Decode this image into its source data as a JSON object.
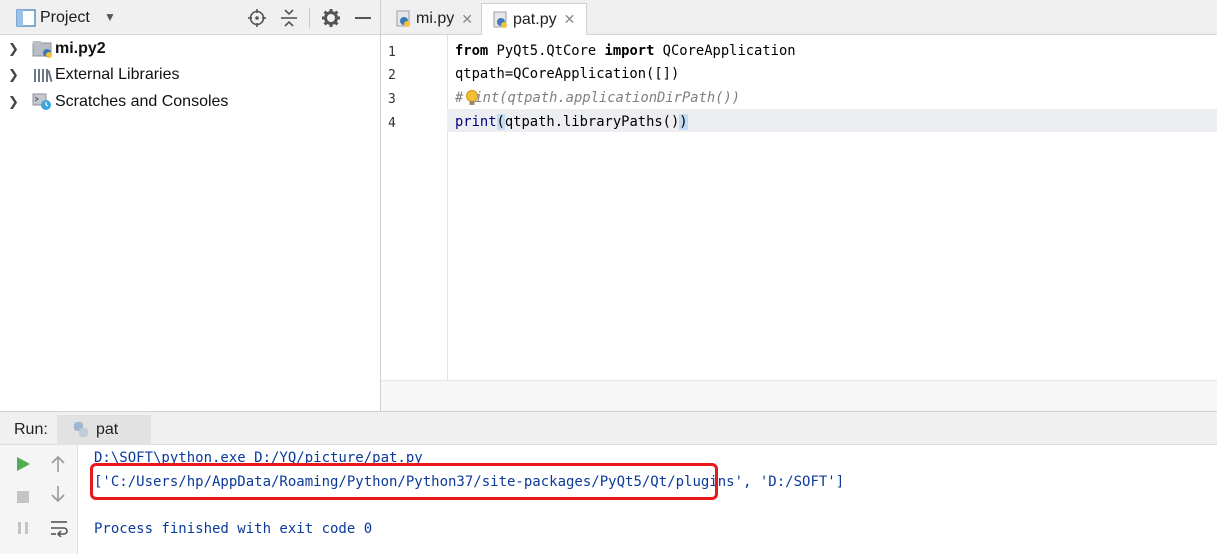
{
  "project": {
    "title": "Project",
    "tree": [
      {
        "label": "mi.py2",
        "bold": true,
        "icon": "folder-icon"
      },
      {
        "label": "External Libraries",
        "icon": "libraries-icon"
      },
      {
        "label": "Scratches and Consoles",
        "icon": "scratches-icon"
      }
    ]
  },
  "editor": {
    "tabs": [
      {
        "label": "mi.py",
        "active": false,
        "icon": "python-file-icon"
      },
      {
        "label": "pat.py",
        "active": true,
        "icon": "python-file-icon"
      }
    ],
    "line_numbers": [
      "1",
      "2",
      "3",
      "4"
    ],
    "code": {
      "line1": {
        "kw_from": "from",
        "module": " PyQt5.QtCore ",
        "kw_import": "import",
        "name": " QCoreApplication"
      },
      "line2": {
        "text": "qtpath=QCoreApplication([])"
      },
      "line3": {
        "hash": "#",
        "rest": "int(qtpath.applicationDirPath())"
      },
      "line4": {
        "func": "print",
        "open": "(",
        "args": "qtpath.libraryPaths()",
        "close": ")"
      }
    }
  },
  "run": {
    "label": "Run:",
    "tab": "pat",
    "console": {
      "command": "D:\\SOFT\\python.exe D:/YQ/picture/pat.py",
      "output_highlighted": "['C:/Users/hp/AppData/Roaming/Python/Python37/site-packages/PyQt5/Qt/plugins'",
      "output_rest": ", 'D:/SOFT']",
      "exit": "Process finished with exit code 0"
    }
  },
  "colors": {
    "console_text": "#0b3a9a",
    "highlight_box": "#e8191b",
    "run_green": "#4caf50"
  }
}
